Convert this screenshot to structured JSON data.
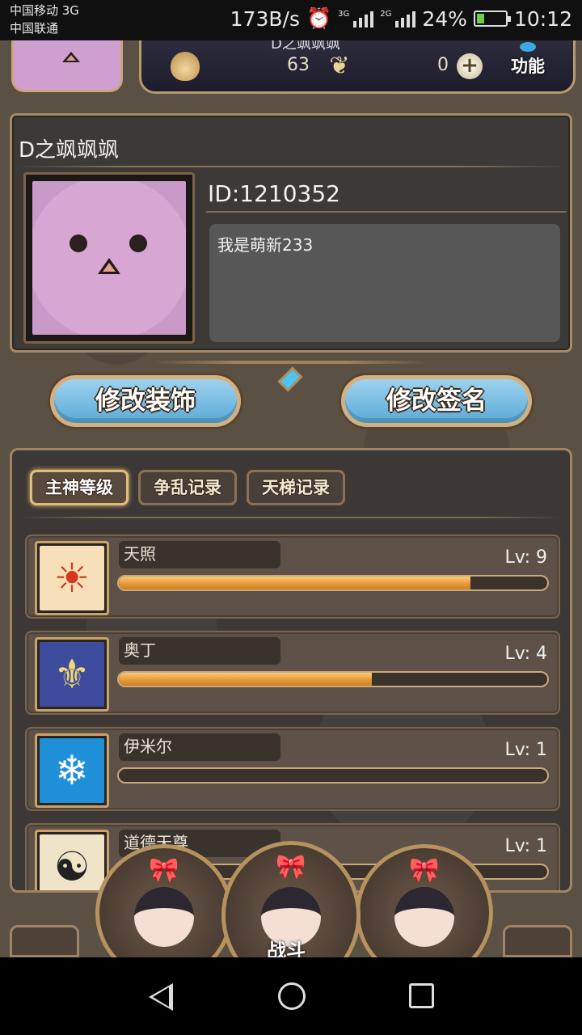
{
  "status_bar": {
    "carrier1": "中国移动 3G",
    "carrier2": "中国联通",
    "speed": "173B/s",
    "sim1_type": "3G",
    "sim2_type": "2G",
    "battery": "24%",
    "time": "10:12"
  },
  "top_bar": {
    "player_name_partial": "D之飒飒飒",
    "resource1": "63",
    "resource2": "0",
    "function_label": "功能"
  },
  "profile": {
    "nickname": "D之飒飒飒",
    "id": "ID:1210352",
    "signature": "我是萌新233"
  },
  "buttons": {
    "edit_decoration": "修改装饰",
    "edit_signature": "修改签名"
  },
  "tabs": [
    {
      "label": "主神等级",
      "active": true
    },
    {
      "label": "争乱记录",
      "active": false
    },
    {
      "label": "天梯记录",
      "active": false
    }
  ],
  "gods": [
    {
      "name": "天照",
      "level": "Lv: 9",
      "progress": 0.82,
      "icon": "sun-icon"
    },
    {
      "name": "奥丁",
      "level": "Lv: 4",
      "progress": 0.59,
      "icon": "odin-wings-icon"
    },
    {
      "name": "伊米尔",
      "level": "Lv: 1",
      "progress": 0.0,
      "icon": "ymir-icon"
    },
    {
      "name": "道德天尊",
      "level": "Lv: 1",
      "progress": 0.0,
      "icon": "yin-yang-icon"
    }
  ],
  "bottom_nav": {
    "center_label": "战斗"
  },
  "colors": {
    "accent_gold": "#c9a36b",
    "button_blue": "#5aaad7",
    "progress_orange": "#e39534"
  }
}
